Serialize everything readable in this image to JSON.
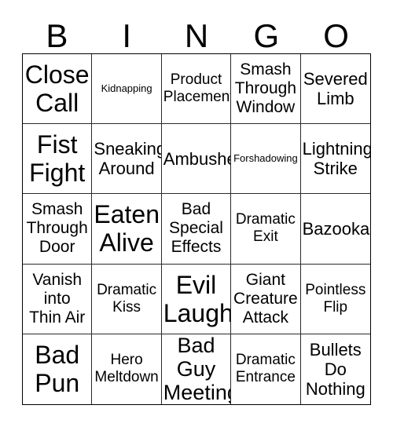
{
  "header": {
    "letters": [
      "B",
      "I",
      "N",
      "G",
      "O"
    ]
  },
  "grid": {
    "rows": [
      [
        {
          "text": "Close\nCall",
          "size": "fs-xl"
        },
        {
          "text": "Kidnapping",
          "size": "fs-xxs"
        },
        {
          "text": "Product\nPlacement",
          "size": "fs-xs"
        },
        {
          "text": "Smash\nThrough\nWindow",
          "size": "fs-sm"
        },
        {
          "text": "Severed\nLimb",
          "size": "fs-md"
        }
      ],
      [
        {
          "text": "Fist\nFight",
          "size": "fs-xl"
        },
        {
          "text": "Sneaking\nAround",
          "size": "fs-md"
        },
        {
          "text": "Ambushed",
          "size": "fs-md"
        },
        {
          "text": "Forshadowing",
          "size": "fs-xxs"
        },
        {
          "text": "Lightning\nStrike",
          "size": "fs-md"
        }
      ],
      [
        {
          "text": "Smash\nThrough\nDoor",
          "size": "fs-sm"
        },
        {
          "text": "Eaten\nAlive",
          "size": "fs-xl"
        },
        {
          "text": "Bad\nSpecial\nEffects",
          "size": "fs-sm"
        },
        {
          "text": "Dramatic\nExit",
          "size": "fs-xs"
        },
        {
          "text": "Bazooka",
          "size": "fs-md"
        }
      ],
      [
        {
          "text": "Vanish\ninto\nThin Air",
          "size": "fs-sm"
        },
        {
          "text": "Dramatic\nKiss",
          "size": "fs-xs"
        },
        {
          "text": "Evil\nLaugh",
          "size": "fs-xl"
        },
        {
          "text": "Giant\nCreature\nAttack",
          "size": "fs-sm"
        },
        {
          "text": "Pointless\nFlip",
          "size": "fs-xs"
        }
      ],
      [
        {
          "text": "Bad\nPun",
          "size": "fs-xl"
        },
        {
          "text": "Hero\nMeltdown",
          "size": "fs-xs"
        },
        {
          "text": "Bad\nGuy\nMeeting",
          "size": "fs-lg"
        },
        {
          "text": "Dramatic\nEntrance",
          "size": "fs-xs"
        },
        {
          "text": "Bullets\nDo\nNothing",
          "size": "fs-md"
        }
      ]
    ]
  },
  "colors": {
    "background": "#ffffff",
    "text": "#000000",
    "border": "#000000",
    "inner_border": "#2a2a2a"
  }
}
